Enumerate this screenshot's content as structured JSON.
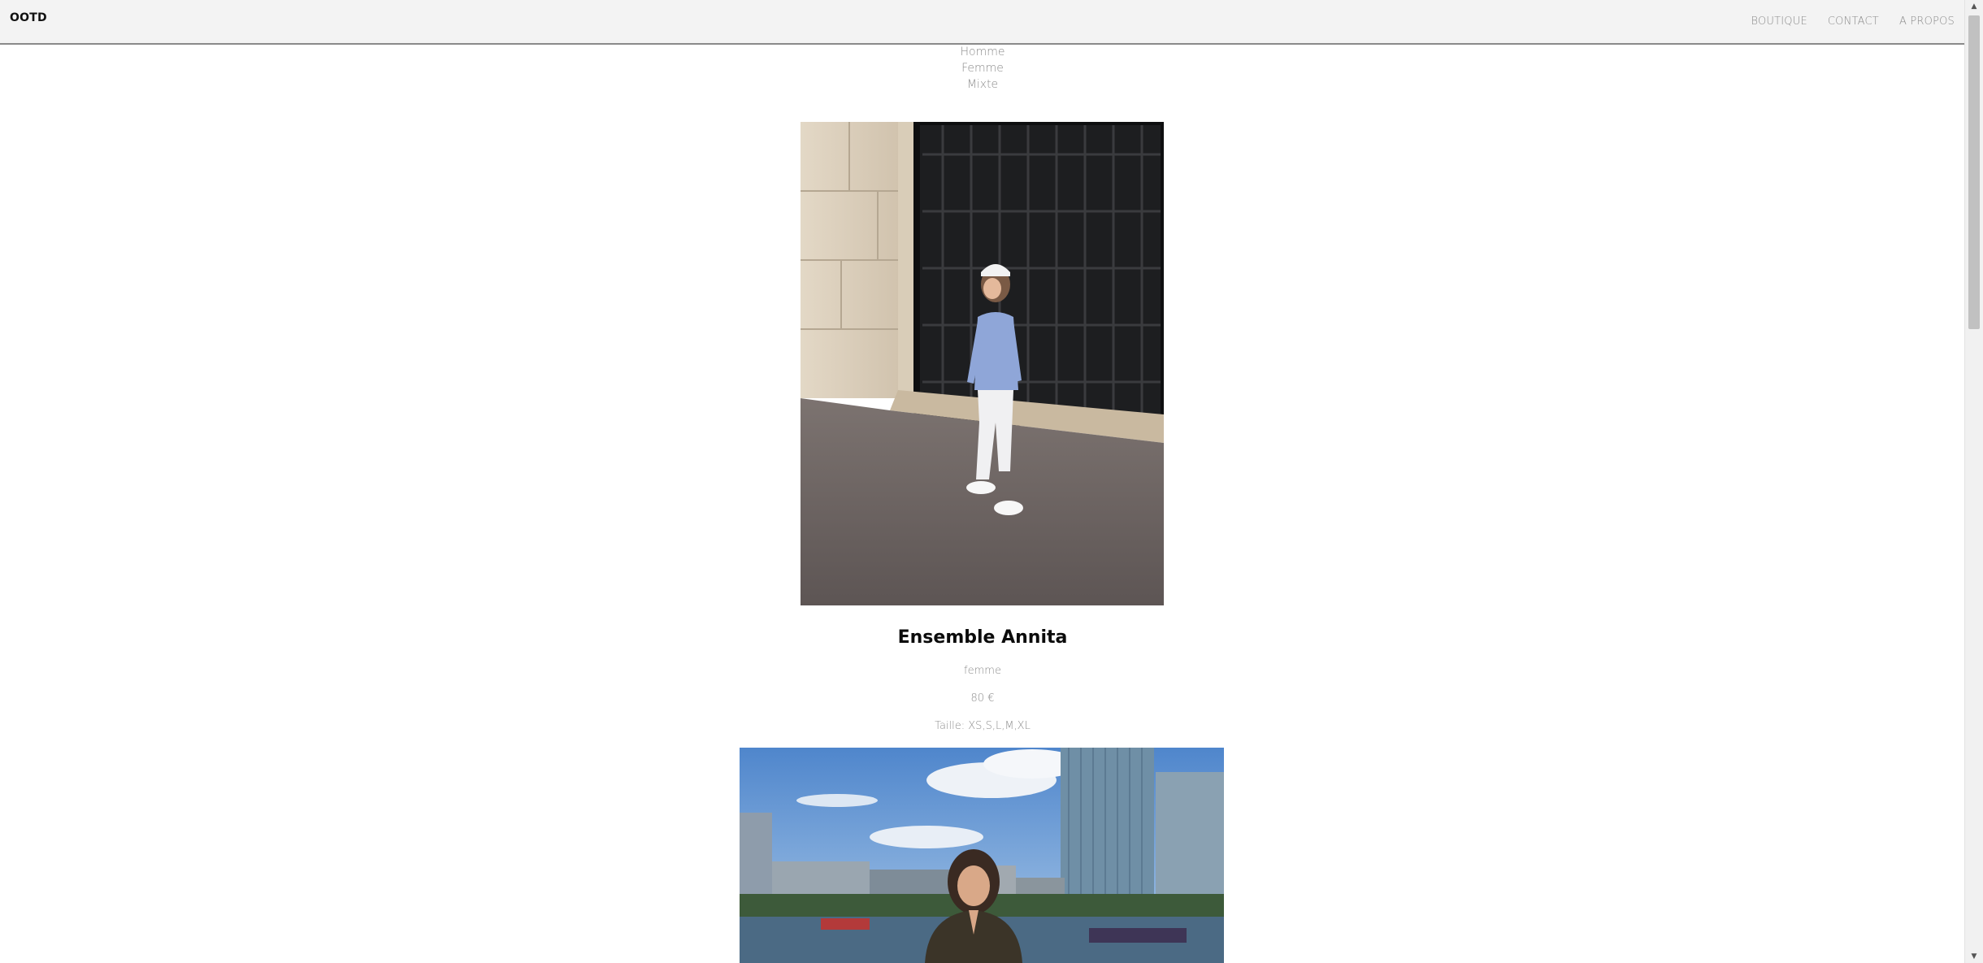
{
  "header": {
    "logo": "OOTD",
    "nav": [
      {
        "label": "BOUTIQUE"
      },
      {
        "label": "CONTACT"
      },
      {
        "label": "A PROPOS"
      }
    ]
  },
  "filters": [
    "Homme",
    "Femme",
    "Mixte"
  ],
  "products": [
    {
      "title": "Ensemble Annita",
      "category": "femme",
      "price": "80 €",
      "sizes": "Taille: XS,S,L,M,XL"
    }
  ],
  "colors": {
    "header_bg": "#f3f3f3",
    "muted_text": "#8c8c8c",
    "title_text": "#0b0b0b"
  }
}
